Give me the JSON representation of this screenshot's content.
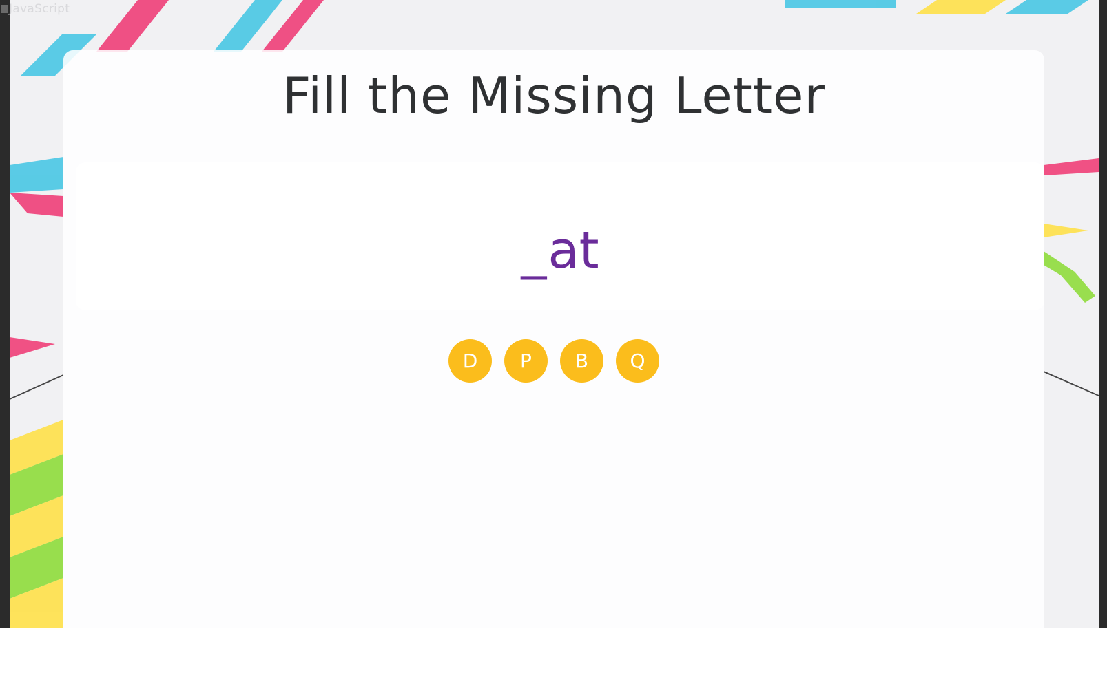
{
  "tab": {
    "label": "JavaScript"
  },
  "game": {
    "title": "Fill the Missing Letter",
    "word": {
      "blank": "_",
      "rest": "at"
    },
    "options": [
      "D",
      "P",
      "B",
      "Q"
    ]
  },
  "colors": {
    "title": "#2f3133",
    "word": "#6a2c9a",
    "option_bg": "#fbbd1c",
    "option_text": "#ffffff"
  }
}
